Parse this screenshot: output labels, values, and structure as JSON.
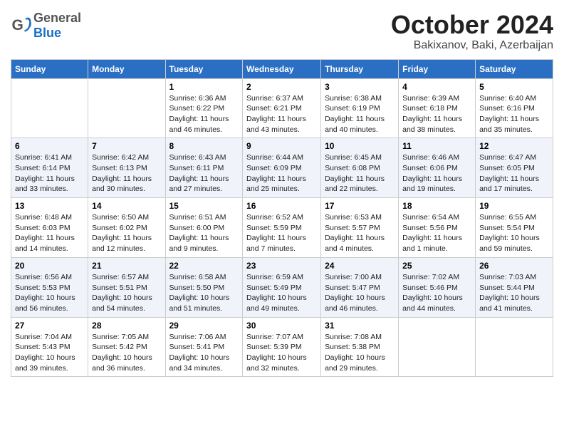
{
  "header": {
    "logo_general": "General",
    "logo_blue": "Blue",
    "month_title": "October 2024",
    "location": "Bakixanov, Baki, Azerbaijan"
  },
  "weekdays": [
    "Sunday",
    "Monday",
    "Tuesday",
    "Wednesday",
    "Thursday",
    "Friday",
    "Saturday"
  ],
  "weeks": [
    [
      {
        "day": "",
        "sunrise": "",
        "sunset": "",
        "daylight": ""
      },
      {
        "day": "",
        "sunrise": "",
        "sunset": "",
        "daylight": ""
      },
      {
        "day": "1",
        "sunrise": "Sunrise: 6:36 AM",
        "sunset": "Sunset: 6:22 PM",
        "daylight": "Daylight: 11 hours and 46 minutes."
      },
      {
        "day": "2",
        "sunrise": "Sunrise: 6:37 AM",
        "sunset": "Sunset: 6:21 PM",
        "daylight": "Daylight: 11 hours and 43 minutes."
      },
      {
        "day": "3",
        "sunrise": "Sunrise: 6:38 AM",
        "sunset": "Sunset: 6:19 PM",
        "daylight": "Daylight: 11 hours and 40 minutes."
      },
      {
        "day": "4",
        "sunrise": "Sunrise: 6:39 AM",
        "sunset": "Sunset: 6:18 PM",
        "daylight": "Daylight: 11 hours and 38 minutes."
      },
      {
        "day": "5",
        "sunrise": "Sunrise: 6:40 AM",
        "sunset": "Sunset: 6:16 PM",
        "daylight": "Daylight: 11 hours and 35 minutes."
      }
    ],
    [
      {
        "day": "6",
        "sunrise": "Sunrise: 6:41 AM",
        "sunset": "Sunset: 6:14 PM",
        "daylight": "Daylight: 11 hours and 33 minutes."
      },
      {
        "day": "7",
        "sunrise": "Sunrise: 6:42 AM",
        "sunset": "Sunset: 6:13 PM",
        "daylight": "Daylight: 11 hours and 30 minutes."
      },
      {
        "day": "8",
        "sunrise": "Sunrise: 6:43 AM",
        "sunset": "Sunset: 6:11 PM",
        "daylight": "Daylight: 11 hours and 27 minutes."
      },
      {
        "day": "9",
        "sunrise": "Sunrise: 6:44 AM",
        "sunset": "Sunset: 6:09 PM",
        "daylight": "Daylight: 11 hours and 25 minutes."
      },
      {
        "day": "10",
        "sunrise": "Sunrise: 6:45 AM",
        "sunset": "Sunset: 6:08 PM",
        "daylight": "Daylight: 11 hours and 22 minutes."
      },
      {
        "day": "11",
        "sunrise": "Sunrise: 6:46 AM",
        "sunset": "Sunset: 6:06 PM",
        "daylight": "Daylight: 11 hours and 19 minutes."
      },
      {
        "day": "12",
        "sunrise": "Sunrise: 6:47 AM",
        "sunset": "Sunset: 6:05 PM",
        "daylight": "Daylight: 11 hours and 17 minutes."
      }
    ],
    [
      {
        "day": "13",
        "sunrise": "Sunrise: 6:48 AM",
        "sunset": "Sunset: 6:03 PM",
        "daylight": "Daylight: 11 hours and 14 minutes."
      },
      {
        "day": "14",
        "sunrise": "Sunrise: 6:50 AM",
        "sunset": "Sunset: 6:02 PM",
        "daylight": "Daylight: 11 hours and 12 minutes."
      },
      {
        "day": "15",
        "sunrise": "Sunrise: 6:51 AM",
        "sunset": "Sunset: 6:00 PM",
        "daylight": "Daylight: 11 hours and 9 minutes."
      },
      {
        "day": "16",
        "sunrise": "Sunrise: 6:52 AM",
        "sunset": "Sunset: 5:59 PM",
        "daylight": "Daylight: 11 hours and 7 minutes."
      },
      {
        "day": "17",
        "sunrise": "Sunrise: 6:53 AM",
        "sunset": "Sunset: 5:57 PM",
        "daylight": "Daylight: 11 hours and 4 minutes."
      },
      {
        "day": "18",
        "sunrise": "Sunrise: 6:54 AM",
        "sunset": "Sunset: 5:56 PM",
        "daylight": "Daylight: 11 hours and 1 minute."
      },
      {
        "day": "19",
        "sunrise": "Sunrise: 6:55 AM",
        "sunset": "Sunset: 5:54 PM",
        "daylight": "Daylight: 10 hours and 59 minutes."
      }
    ],
    [
      {
        "day": "20",
        "sunrise": "Sunrise: 6:56 AM",
        "sunset": "Sunset: 5:53 PM",
        "daylight": "Daylight: 10 hours and 56 minutes."
      },
      {
        "day": "21",
        "sunrise": "Sunrise: 6:57 AM",
        "sunset": "Sunset: 5:51 PM",
        "daylight": "Daylight: 10 hours and 54 minutes."
      },
      {
        "day": "22",
        "sunrise": "Sunrise: 6:58 AM",
        "sunset": "Sunset: 5:50 PM",
        "daylight": "Daylight: 10 hours and 51 minutes."
      },
      {
        "day": "23",
        "sunrise": "Sunrise: 6:59 AM",
        "sunset": "Sunset: 5:49 PM",
        "daylight": "Daylight: 10 hours and 49 minutes."
      },
      {
        "day": "24",
        "sunrise": "Sunrise: 7:00 AM",
        "sunset": "Sunset: 5:47 PM",
        "daylight": "Daylight: 10 hours and 46 minutes."
      },
      {
        "day": "25",
        "sunrise": "Sunrise: 7:02 AM",
        "sunset": "Sunset: 5:46 PM",
        "daylight": "Daylight: 10 hours and 44 minutes."
      },
      {
        "day": "26",
        "sunrise": "Sunrise: 7:03 AM",
        "sunset": "Sunset: 5:44 PM",
        "daylight": "Daylight: 10 hours and 41 minutes."
      }
    ],
    [
      {
        "day": "27",
        "sunrise": "Sunrise: 7:04 AM",
        "sunset": "Sunset: 5:43 PM",
        "daylight": "Daylight: 10 hours and 39 minutes."
      },
      {
        "day": "28",
        "sunrise": "Sunrise: 7:05 AM",
        "sunset": "Sunset: 5:42 PM",
        "daylight": "Daylight: 10 hours and 36 minutes."
      },
      {
        "day": "29",
        "sunrise": "Sunrise: 7:06 AM",
        "sunset": "Sunset: 5:41 PM",
        "daylight": "Daylight: 10 hours and 34 minutes."
      },
      {
        "day": "30",
        "sunrise": "Sunrise: 7:07 AM",
        "sunset": "Sunset: 5:39 PM",
        "daylight": "Daylight: 10 hours and 32 minutes."
      },
      {
        "day": "31",
        "sunrise": "Sunrise: 7:08 AM",
        "sunset": "Sunset: 5:38 PM",
        "daylight": "Daylight: 10 hours and 29 minutes."
      },
      {
        "day": "",
        "sunrise": "",
        "sunset": "",
        "daylight": ""
      },
      {
        "day": "",
        "sunrise": "",
        "sunset": "",
        "daylight": ""
      }
    ]
  ]
}
